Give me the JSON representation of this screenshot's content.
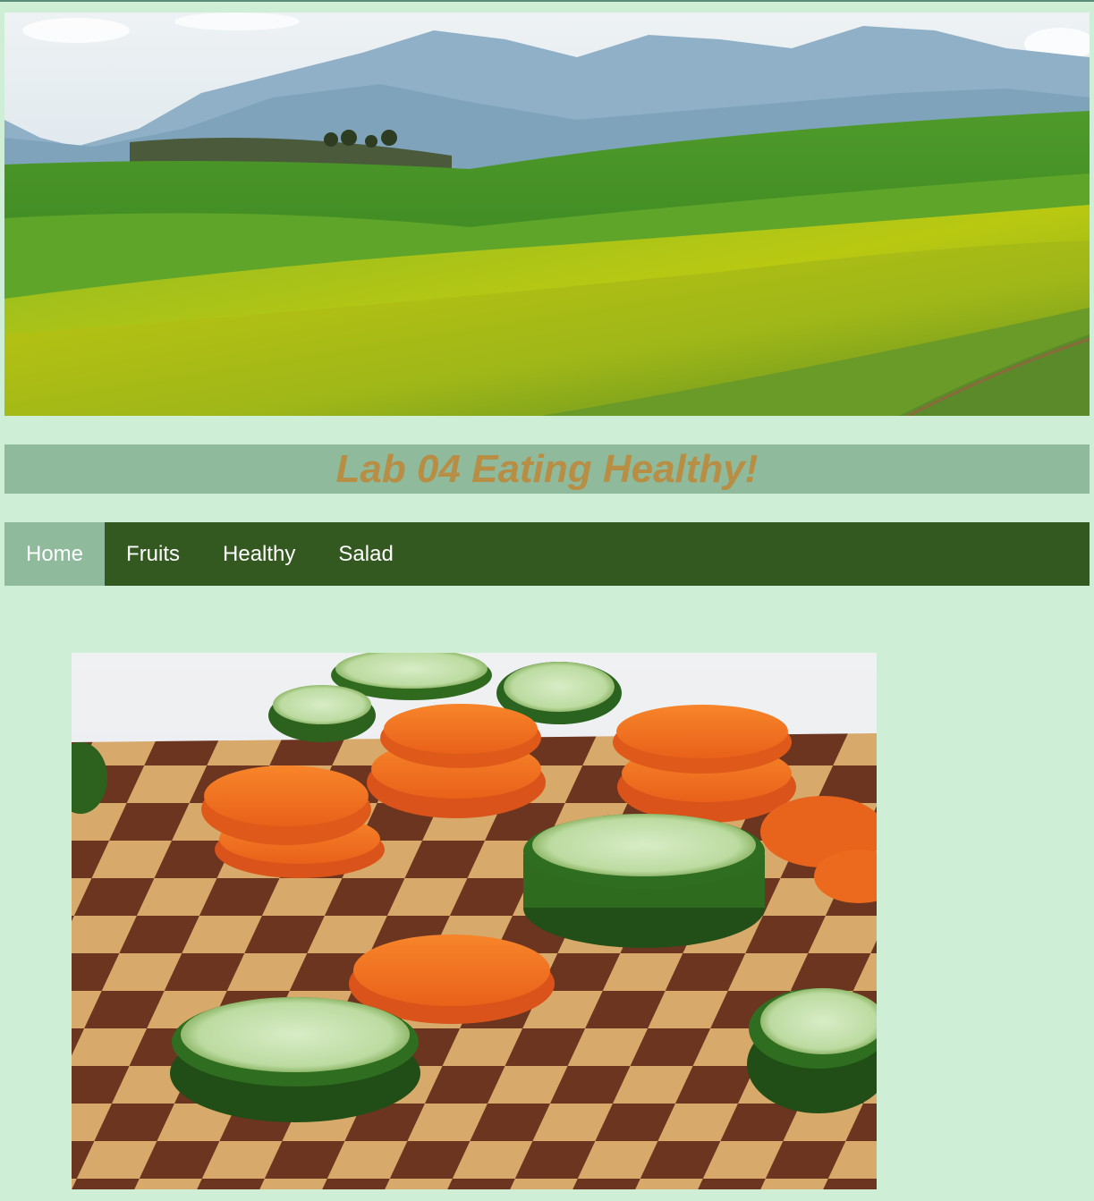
{
  "header": {
    "banner_image": "green-hills-landscape",
    "title": "Lab 04 Eating Healthy!"
  },
  "nav": {
    "items": [
      {
        "label": "Home",
        "active": true
      },
      {
        "label": "Fruits",
        "active": false
      },
      {
        "label": "Healthy",
        "active": false
      },
      {
        "label": "Salad",
        "active": false
      }
    ]
  },
  "main": {
    "image": "carrot-and-cucumber-slices-on-chessboard"
  },
  "colors": {
    "page_background": "#cfeed6",
    "title_bar": "#8fba9c",
    "title_text": "#b88d44",
    "nav_background": "#335920",
    "nav_active": "#8fba9c",
    "nav_text": "#ffffff"
  }
}
